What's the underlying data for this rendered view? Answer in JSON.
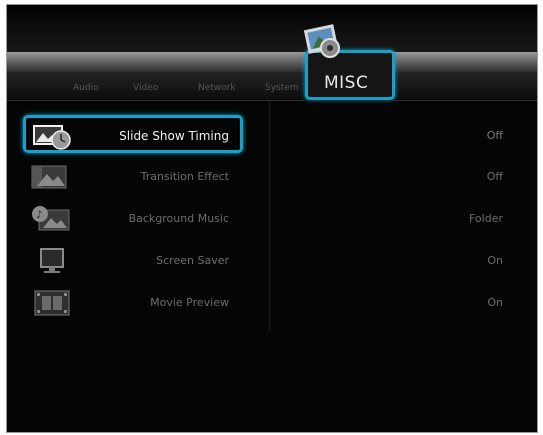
{
  "tabs": [
    {
      "label": "Audio"
    },
    {
      "label": "Video"
    },
    {
      "label": "Network"
    },
    {
      "label": "System"
    }
  ],
  "active_tab": {
    "label": "MISC",
    "icon": "photo-icon"
  },
  "settings": [
    {
      "label": "Slide Show Timing",
      "value": "Off",
      "icon": "slideshow-clock-icon",
      "selected": true
    },
    {
      "label": "Transition Effect",
      "value": "Off",
      "icon": "transition-image-icon",
      "selected": false
    },
    {
      "label": "Background Music",
      "value": "Folder",
      "icon": "music-image-icon",
      "selected": false
    },
    {
      "label": "Screen Saver",
      "value": "On",
      "icon": "monitor-icon",
      "selected": false
    },
    {
      "label": "Movie Preview",
      "value": "On",
      "icon": "film-icon",
      "selected": false
    }
  ],
  "colors": {
    "accent": "#1aa0c8",
    "background": "#050505"
  }
}
